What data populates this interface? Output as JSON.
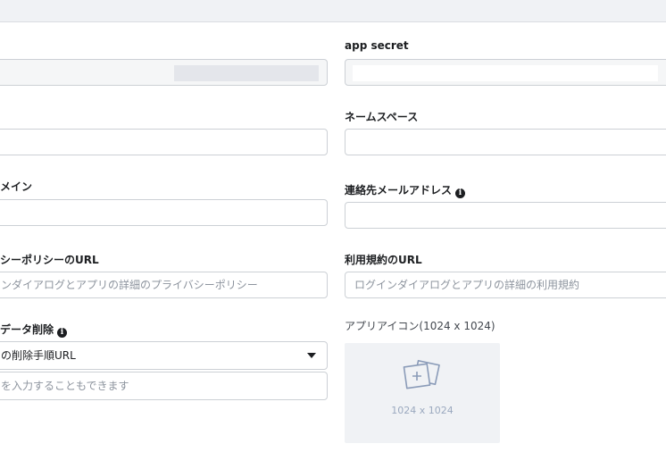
{
  "form": {
    "app_secret": {
      "label": "app secret"
    },
    "namespace": {
      "label": "ネームスペース"
    },
    "domain": {
      "label": "メイン"
    },
    "contact_email": {
      "label": "連絡先メールアドレス"
    },
    "privacy_url": {
      "label": "シーポリシーのURL",
      "placeholder": "ンダイアログとアプリの詳細のプライバシーポリシー"
    },
    "terms_url": {
      "label": "利用規約のURL",
      "placeholder": "ログインダイアログとアプリの詳細の利用規約"
    },
    "data_deletion": {
      "label": "データ削除",
      "selected": "の削除手順URL",
      "placeholder": "を入力することもできます"
    },
    "app_icon": {
      "label": "アプリアイコン(1024 x 1024)",
      "size": "1024 x 1024"
    }
  },
  "icons": {
    "info": "info-icon",
    "dropdown": "caret-down-icon",
    "upload": "add-image-icon"
  },
  "colors": {
    "border": "#ccd0d5",
    "masked": "#e4e6eb",
    "placeholder": "#8d949e",
    "icon_bg": "#f0f2f5",
    "icon_stroke": "#8a9bb8"
  }
}
